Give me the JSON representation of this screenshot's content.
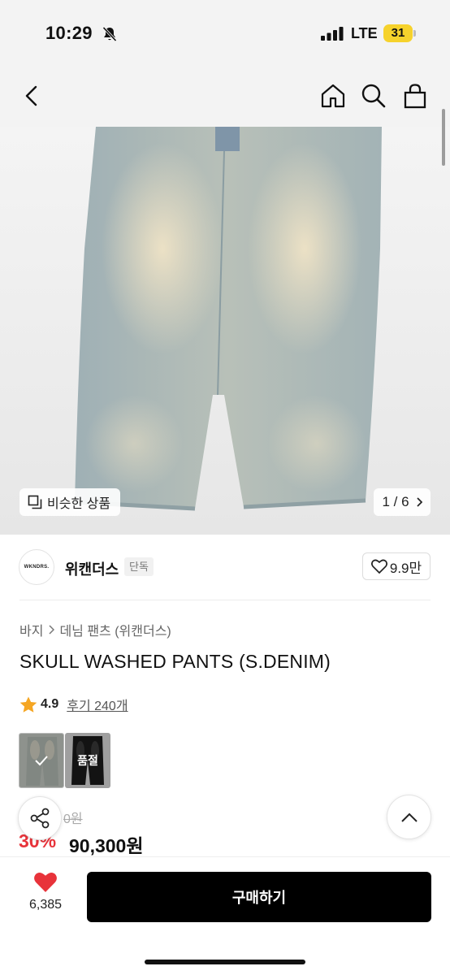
{
  "status_bar": {
    "time": "10:29",
    "network": "LTE",
    "battery": "31",
    "icons": [
      "bell-slash-icon",
      "signal-icon"
    ]
  },
  "nav": {
    "icons": [
      "back-icon",
      "home-icon",
      "search-icon",
      "shopping-bag-icon"
    ]
  },
  "gallery": {
    "similar_label": "비슷한 상품",
    "page_indicator": "1 / 6",
    "icons": [
      "similar-icon",
      "chevron-right-icon"
    ]
  },
  "brand": {
    "logo_text": "WKNDRS.",
    "name": "위캔더스",
    "badge": "단독",
    "likes": "9.9만"
  },
  "product": {
    "breadcrumb": [
      "바지",
      "데님 팬츠 (위캔더스)"
    ],
    "title": "SKULL WASHED PANTS (S.DENIM)",
    "rating": "4.9",
    "reviews": "후기 240개",
    "soldout_label": "품절",
    "original_price": "0원",
    "discount": "30%",
    "price": "90,300원"
  },
  "bottom_bar": {
    "heart_count": "6,385",
    "buy_label": "구매하기"
  },
  "colors": {
    "accent_red": "#e8333a",
    "battery_yellow": "#f6d22c",
    "buy_button": "#000000"
  }
}
